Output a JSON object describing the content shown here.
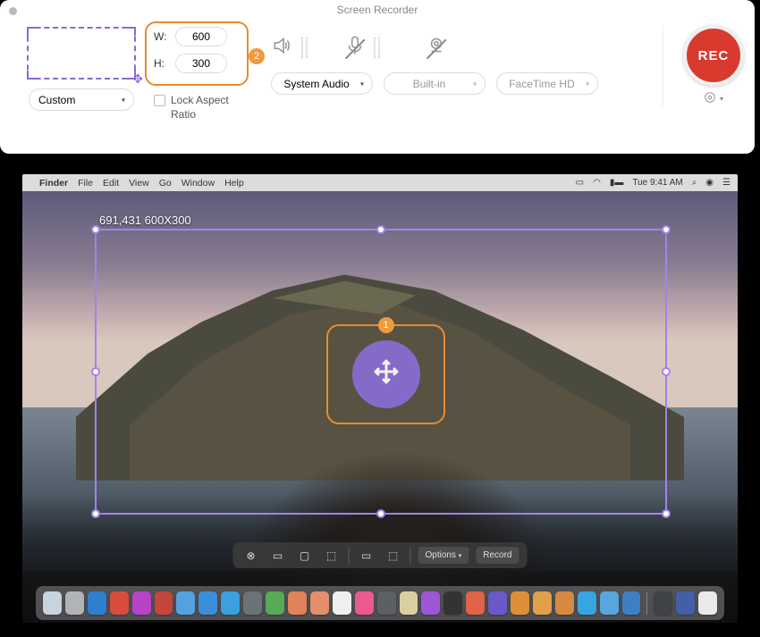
{
  "app": {
    "title": "Screen Recorder"
  },
  "region": {
    "preset": "Custom"
  },
  "dims": {
    "width_label": "W:",
    "height_label": "H:",
    "width_value": "600",
    "height_value": "300",
    "lock_label": "Lock Aspect Ratio",
    "badge": "2"
  },
  "audio": {
    "source": "System Audio",
    "mic": "Built-in",
    "camera": "FaceTime HD"
  },
  "record": {
    "label": "REC"
  },
  "selection": {
    "info": "691,431 600X300"
  },
  "center": {
    "badge": "1"
  },
  "macmenu": {
    "items": [
      "Finder",
      "File",
      "Edit",
      "View",
      "Go",
      "Window",
      "Help"
    ],
    "time": "Tue 9:41 AM"
  },
  "screenshot_bar": {
    "options": "Options",
    "record": "Record"
  },
  "dock_colors": [
    "#c8d3e0",
    "#b0b4b8",
    "#2f7fd1",
    "#d94c3d",
    "#b843c9",
    "#c4453a",
    "#53a2e0",
    "#3b8fd8",
    "#3aa0e0",
    "#6b7278",
    "#57aa58",
    "#e0835a",
    "#e28f6a",
    "#efefef",
    "#eb5a8f",
    "#5c5f63",
    "#d9cfa1",
    "#9e56d6",
    "#333333",
    "#e06248",
    "#6a59c6",
    "#de8f35",
    "#e2a04a",
    "#d78a3f",
    "#37a6e0",
    "#59a5de",
    "#3c7fc4",
    "#404346",
    "#425fa7",
    "#eaeaea"
  ]
}
